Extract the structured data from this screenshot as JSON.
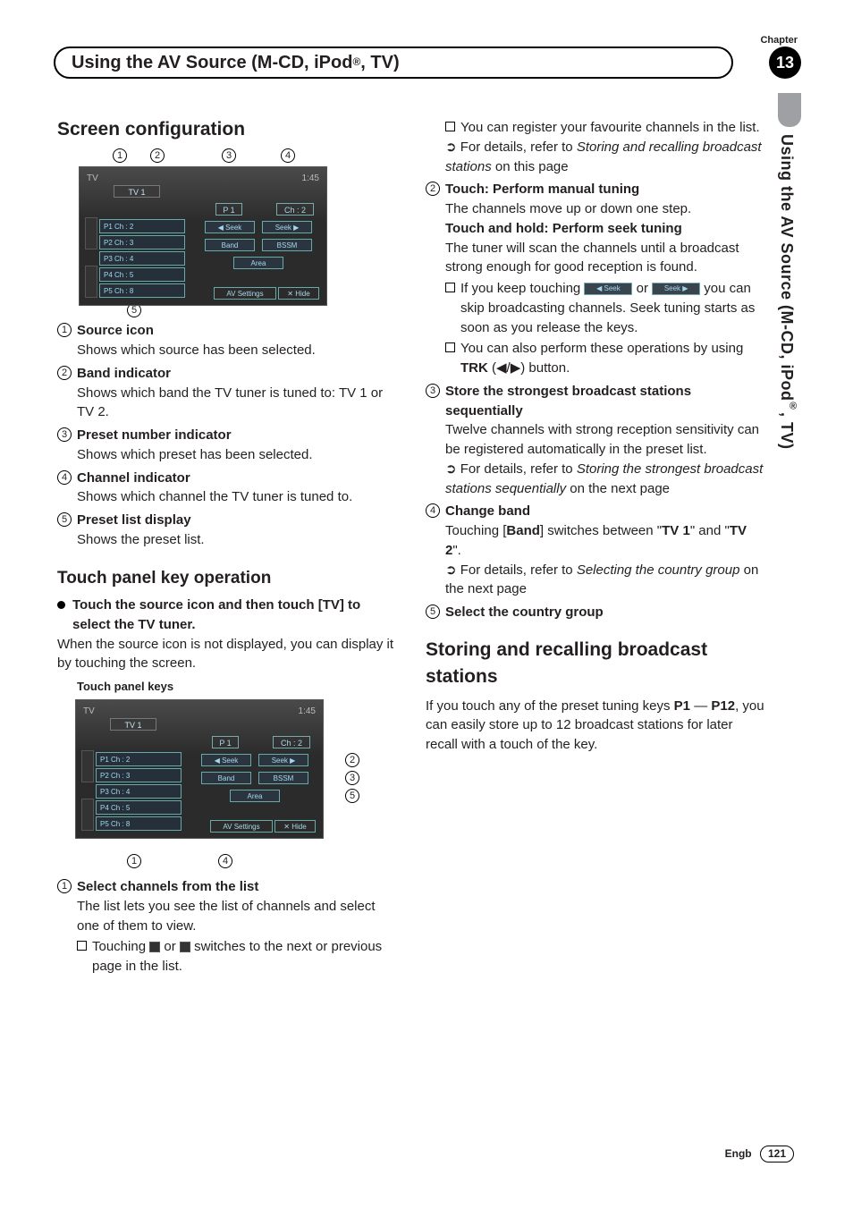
{
  "chapter": {
    "label": "Chapter",
    "number": "13"
  },
  "pageTitle": {
    "prefix": "Using the AV Source (M-CD, iPod",
    "sup": "®",
    "suffix": ", TV)"
  },
  "sideText": {
    "prefix": "Using the AV Source (M-CD, iPod",
    "sup": "®",
    "suffix": ", TV)"
  },
  "left": {
    "h2": "Screen configuration",
    "tv": {
      "src": "TV",
      "time": "1:45",
      "band": "TV 1",
      "p": "P 1",
      "ch": "Ch : 2",
      "presets": [
        "P1    Ch : 2",
        "P2    Ch : 3",
        "P3    Ch : 4",
        "P4    Ch : 5",
        "P5    Ch : 8"
      ],
      "seekL": "◀   Seek",
      "seekR": "Seek   ▶",
      "bandBtn": "Band",
      "bssm": "BSSM",
      "area": "Area",
      "avset": "AV Settings",
      "hide": "✕ Hide"
    },
    "callouts": {
      "c1": "1",
      "c2": "2",
      "c3": "3",
      "c4": "4",
      "c5": "5"
    },
    "defs": [
      {
        "n": "1",
        "title": "Source icon",
        "body": "Shows which source has been selected."
      },
      {
        "n": "2",
        "title": "Band indicator",
        "body": "Shows which band the TV tuner is tuned to: TV 1 or TV 2."
      },
      {
        "n": "3",
        "title": "Preset number indicator",
        "body": "Shows which preset has been selected."
      },
      {
        "n": "4",
        "title": "Channel indicator",
        "body": "Shows which channel the TV tuner is tuned to."
      },
      {
        "n": "5",
        "title": "Preset list display",
        "body": "Shows the preset list."
      }
    ],
    "h3": "Touch panel key operation",
    "touchLead": {
      "bold": "Touch the source icon and then touch [TV] to select the TV tuner."
    },
    "touchBody": "When the source icon is not displayed, you can display it by touching the screen.",
    "tkCaption": "Touch panel keys",
    "tv2": {
      "src": "TV",
      "time": "1:45",
      "band": "TV 1",
      "p": "P 1",
      "ch": "Ch : 2",
      "presets": [
        "P1    Ch : 2",
        "P2    Ch : 3",
        "P3    Ch : 4",
        "P4    Ch : 5",
        "P5    Ch : 8"
      ],
      "seekL": "◀   Seek",
      "seekR": "Seek   ▶",
      "bandBtn": "Band",
      "bssm": "BSSM",
      "area": "Area",
      "avset": "AV Settings",
      "hide": "✕ Hide"
    },
    "tv2callouts": {
      "c1": "1",
      "c2": "2",
      "c3": "3",
      "c4": "4",
      "c5": "5"
    },
    "def2": {
      "n": "1",
      "title": "Select channels from the list",
      "body": "The list lets you see the list of channels and select one of them to view.",
      "sub": {
        "pre": "Touching ",
        "mid": " or ",
        "post": " switches to the next or previous page in the list."
      }
    }
  },
  "right": {
    "cont": {
      "sub1pre": "You can register your favourite channels in the list.",
      "ref1a": "For details, refer to ",
      "ref1i": "Storing and recalling broadcast stations",
      "ref1b": " on this page"
    },
    "d2": {
      "n": "2",
      "title": "Touch: Perform manual tuning",
      "l1": "The channels move up or down one step.",
      "title2": "Touch and hold: Perform seek tuning",
      "l2": "The tuner will scan the channels until a broadcast strong enough for good reception is found.",
      "s1a": "If you keep touching ",
      "s1b": " or ",
      "s1c": " you can skip broadcasting channels. Seek tuning starts as soon as you release the keys.",
      "s2a": "You can also perform these operations by using ",
      "trk": "TRK",
      "s2b": " (◀/▶) button."
    },
    "d3": {
      "n": "3",
      "title": "Store the strongest broadcast stations sequentially",
      "body": "Twelve channels with strong reception sensitivity can be registered automatically in the preset list.",
      "refA": "For details, refer to ",
      "refI": "Storing the strongest broadcast stations sequentially",
      "refB": " on the next page"
    },
    "d4": {
      "n": "4",
      "title": "Change band",
      "bodyA": "Touching [",
      "bodyBand": "Band",
      "bodyB": "] switches between \"",
      "tv1": "TV 1",
      "bodyC": "\" and \"",
      "tv2": "TV 2",
      "bodyD": "\".",
      "refA": "For details, refer to ",
      "refI": "Selecting the country group",
      "refB": " on the next page"
    },
    "d5": {
      "n": "5",
      "title": "Select the country group"
    },
    "h2": "Storing and recalling broadcast stations",
    "p": {
      "a": "If you touch any of the preset tuning keys ",
      "p1": "P1",
      "b": " — ",
      "p12": "P12",
      "c": ", you can easily store up to 12 broadcast stations for later recall with a touch of the key."
    }
  },
  "footer": {
    "lang": "Engb",
    "page": "121"
  },
  "seekBtn": {
    "left": "◀  Seek",
    "right": "Seek  ▶"
  }
}
